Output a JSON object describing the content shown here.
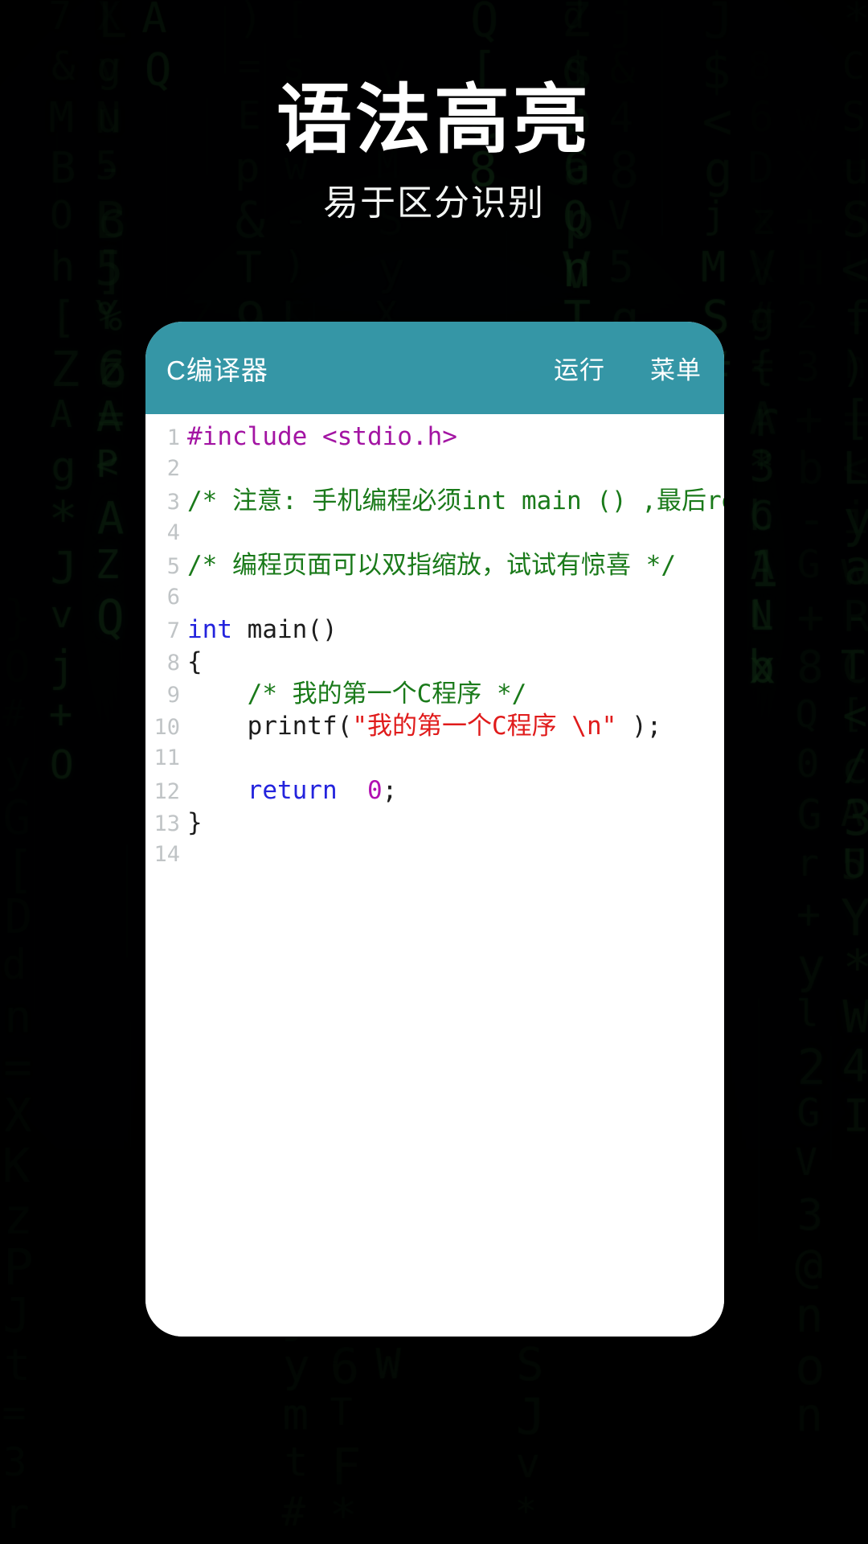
{
  "hero": {
    "title": "语法高亮",
    "subtitle": "易于区分识别"
  },
  "colors": {
    "appbar": "#3596a6",
    "card": "#ffffff",
    "background": "#03060a",
    "preprocessor": "#a314a3",
    "comment": "#1a7a1a",
    "keyword": "#2323dd",
    "string": "#e01b1b",
    "number": "#b210b2",
    "line_number": "#c0c4c6"
  },
  "app": {
    "title": "C编译器",
    "actions": [
      {
        "label": "运行",
        "name": "run-button"
      },
      {
        "label": "菜单",
        "name": "menu-button"
      }
    ]
  },
  "editor": {
    "lines": [
      {
        "n": "1",
        "tokens": [
          {
            "t": "#include <stdio.h>",
            "c": "tok-pre"
          }
        ]
      },
      {
        "n": "2",
        "tokens": []
      },
      {
        "n": "3",
        "tokens": [
          {
            "t": "/* 注意: 手机编程必须int main () ,最后re",
            "c": "tok-cmt"
          }
        ]
      },
      {
        "n": "4",
        "tokens": []
      },
      {
        "n": "5",
        "tokens": [
          {
            "t": "/* 编程页面可以双指缩放，试试有惊喜 */",
            "c": "tok-cmt"
          }
        ]
      },
      {
        "n": "6",
        "tokens": []
      },
      {
        "n": "7",
        "tokens": [
          {
            "t": "int",
            "c": "tok-kw"
          },
          {
            "t": " main()",
            "c": "tok-plain"
          }
        ]
      },
      {
        "n": "8",
        "tokens": [
          {
            "t": "{",
            "c": "tok-plain"
          }
        ]
      },
      {
        "n": "9",
        "tokens": [
          {
            "t": "    /* 我的第一个C程序 */",
            "c": "tok-cmt"
          }
        ]
      },
      {
        "n": "10",
        "tokens": [
          {
            "t": "    printf(",
            "c": "tok-plain"
          },
          {
            "t": "\"我的第一个C程序 \\n\"",
            "c": "tok-str"
          },
          {
            "t": " );",
            "c": "tok-plain"
          }
        ]
      },
      {
        "n": "11",
        "tokens": []
      },
      {
        "n": "12",
        "tokens": [
          {
            "t": "    ",
            "c": "tok-plain"
          },
          {
            "t": "return",
            "c": "tok-kw"
          },
          {
            "t": "  ",
            "c": "tok-plain"
          },
          {
            "t": "0",
            "c": "tok-num"
          },
          {
            "t": ";",
            "c": "tok-plain"
          }
        ]
      },
      {
        "n": "13",
        "tokens": [
          {
            "t": "}",
            "c": "tok-plain"
          }
        ]
      },
      {
        "n": "14",
        "tokens": []
      }
    ]
  },
  "background": {
    "type": "matrix-digital-rain",
    "glyphs": "0123456789ABCDEFGHIJKLMNOPQRSTUVWXYZabcdefghijklmnopqrstuvwxyz+-*/<>[]{}()=#$&@%"
  }
}
